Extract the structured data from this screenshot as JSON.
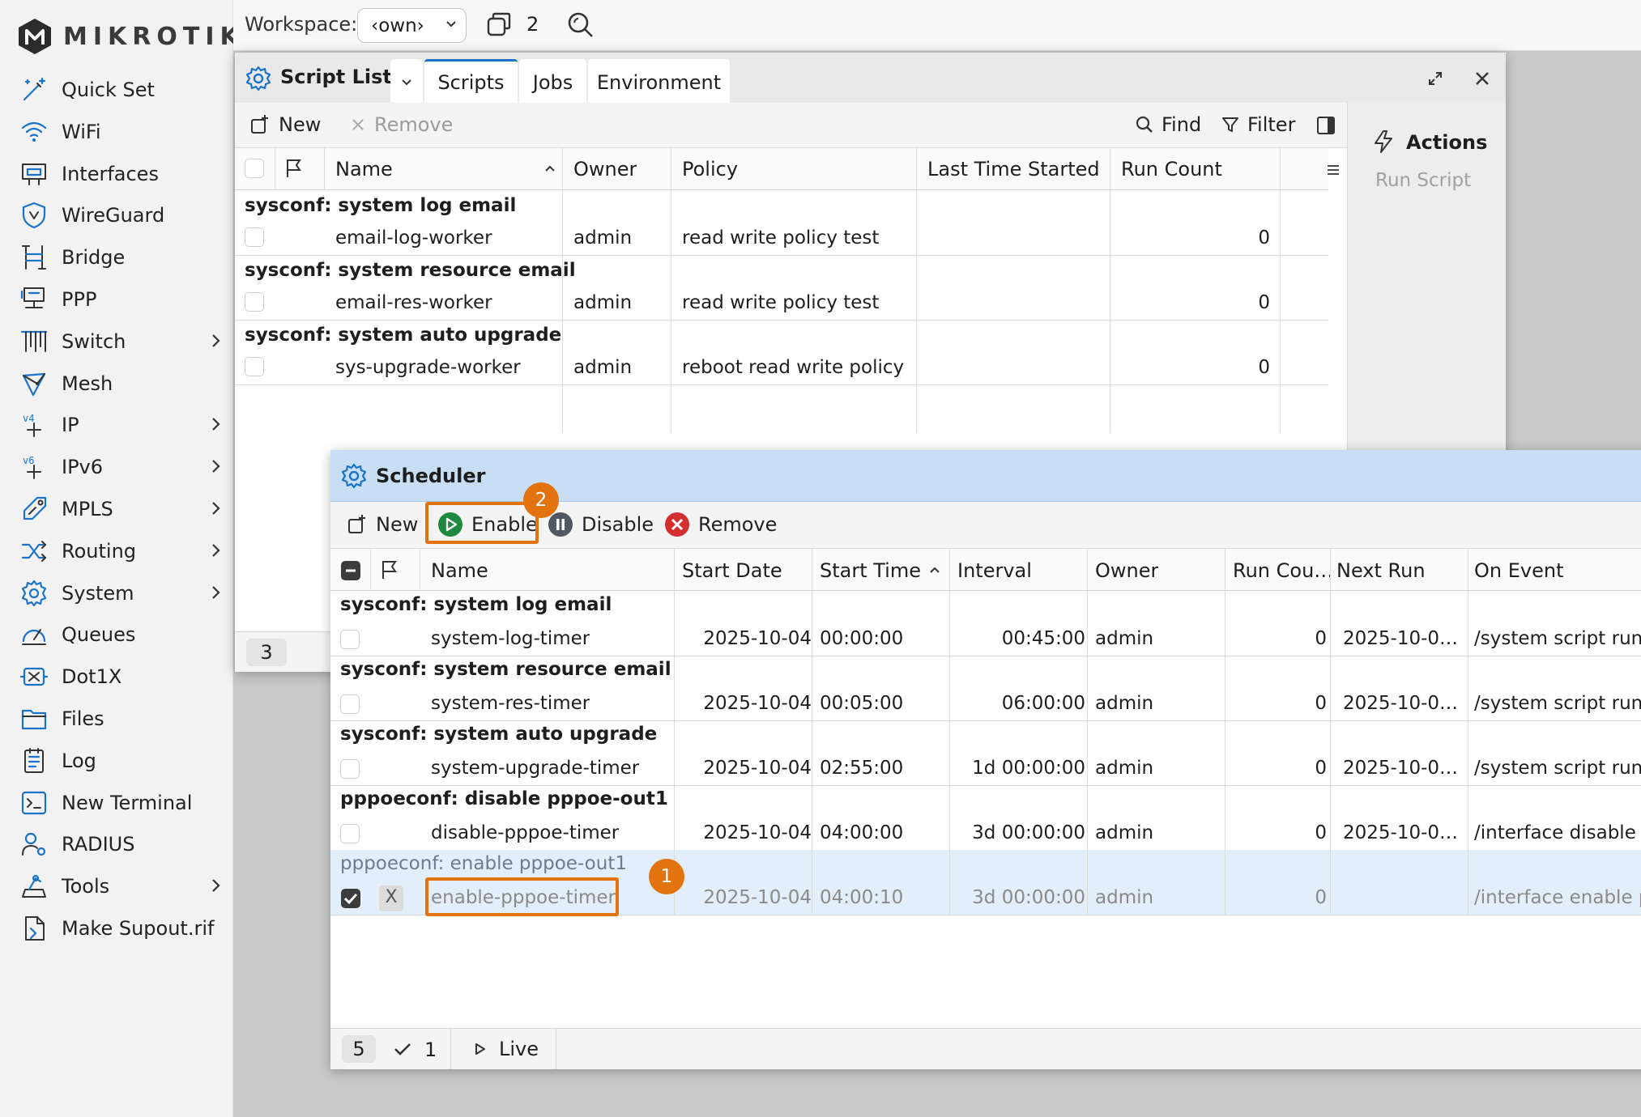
{
  "brand": {
    "logo_text": "MIKROTIK"
  },
  "sidebar": {
    "items": [
      {
        "label": "Quick Set",
        "icon": "wand-icon",
        "submenu": false
      },
      {
        "label": "WiFi",
        "icon": "wifi-icon",
        "submenu": false
      },
      {
        "label": "Interfaces",
        "icon": "interfaces-icon",
        "submenu": false
      },
      {
        "label": "WireGuard",
        "icon": "shield-icon",
        "submenu": false
      },
      {
        "label": "Bridge",
        "icon": "bridge-icon",
        "submenu": false
      },
      {
        "label": "PPP",
        "icon": "ppp-icon",
        "submenu": false
      },
      {
        "label": "Switch",
        "icon": "switch-icon",
        "submenu": true
      },
      {
        "label": "Mesh",
        "icon": "mesh-icon",
        "submenu": false
      },
      {
        "label": "IP",
        "icon": "ip-icon",
        "submenu": true
      },
      {
        "label": "IPv6",
        "icon": "ipv6-icon",
        "submenu": true
      },
      {
        "label": "MPLS",
        "icon": "mpls-icon",
        "submenu": true
      },
      {
        "label": "Routing",
        "icon": "routing-icon",
        "submenu": true
      },
      {
        "label": "System",
        "icon": "gear-icon",
        "submenu": true
      },
      {
        "label": "Queues",
        "icon": "gauge-icon",
        "submenu": false
      },
      {
        "label": "Dot1X",
        "icon": "dot1x-icon",
        "submenu": false
      },
      {
        "label": "Files",
        "icon": "folder-icon",
        "submenu": false
      },
      {
        "label": "Log",
        "icon": "log-icon",
        "submenu": false
      },
      {
        "label": "New Terminal",
        "icon": "terminal-icon",
        "submenu": false
      },
      {
        "label": "RADIUS",
        "icon": "radius-icon",
        "submenu": false
      },
      {
        "label": "Tools",
        "icon": "tools-icon",
        "submenu": true
      },
      {
        "label": "Make Supout.rif",
        "icon": "supout-icon",
        "submenu": false
      }
    ]
  },
  "topbar": {
    "workspace_label": "Workspace:",
    "workspace_value": "‹own›",
    "window_count": "2"
  },
  "script_list": {
    "title": "Script List",
    "tabs": [
      {
        "label": "Scripts",
        "active": true
      },
      {
        "label": "Jobs",
        "active": false
      },
      {
        "label": "Environment",
        "active": false
      }
    ],
    "toolbar": {
      "new": "New",
      "remove": "Remove",
      "find": "Find",
      "filter": "Filter"
    },
    "columns": {
      "name": "Name",
      "owner": "Owner",
      "policy": "Policy",
      "last_started": "Last Time Started",
      "run_count": "Run Count"
    },
    "groups": [
      {
        "title": "sysconf: system log email",
        "name": "email-log-worker",
        "owner": "admin",
        "policy": "read write policy test",
        "last_started": "",
        "run_count": "0"
      },
      {
        "title": "sysconf: system resource email",
        "name": "email-res-worker",
        "owner": "admin",
        "policy": "read write policy test",
        "last_started": "",
        "run_count": "0"
      },
      {
        "title": "sysconf: system auto upgrade",
        "name": "sys-upgrade-worker",
        "owner": "admin",
        "policy": "reboot read write policy",
        "last_started": "",
        "run_count": "0"
      }
    ],
    "status_count": "3",
    "actions": {
      "title": "Actions",
      "run_script": "Run Script"
    }
  },
  "scheduler": {
    "title": "Scheduler",
    "toolbar": {
      "new": "New",
      "enable": "Enable",
      "disable": "Disable",
      "remove": "Remove"
    },
    "columns": {
      "name": "Name",
      "start_date": "Start Date",
      "start_time": "Start Time",
      "interval": "Interval",
      "owner": "Owner",
      "run_count": "Run Cou…",
      "next_run": "Next Run",
      "on_event": "On Event"
    },
    "groups": [
      {
        "title": "sysconf: system log email",
        "name": "system-log-timer",
        "start_date": "2025-10-04",
        "start_time": "00:00:00",
        "interval": "00:45:00",
        "owner": "admin",
        "run_count": "0",
        "next_run": "2025-10-0…",
        "on_event": "/system script run e",
        "selected": false,
        "disabled": false
      },
      {
        "title": "sysconf: system resource email",
        "name": "system-res-timer",
        "start_date": "2025-10-04",
        "start_time": "00:05:00",
        "interval": "06:00:00",
        "owner": "admin",
        "run_count": "0",
        "next_run": "2025-10-0…",
        "on_event": "/system script run e",
        "selected": false,
        "disabled": false
      },
      {
        "title": "sysconf: system auto upgrade",
        "name": "system-upgrade-timer",
        "start_date": "2025-10-04",
        "start_time": "02:55:00",
        "interval": "1d 00:00:00",
        "owner": "admin",
        "run_count": "0",
        "next_run": "2025-10-0…",
        "on_event": "/system script run s",
        "selected": false,
        "disabled": false
      },
      {
        "title": "pppoeconf: disable pppoe-out1",
        "name": "disable-pppoe-timer",
        "start_date": "2025-10-04",
        "start_time": "04:00:00",
        "interval": "3d 00:00:00",
        "owner": "admin",
        "run_count": "0",
        "next_run": "2025-10-0…",
        "on_event": "/interface disable p",
        "selected": false,
        "disabled": false
      },
      {
        "title": "pppoeconf: enable pppoe-out1",
        "name": "enable-pppoe-timer",
        "start_date": "2025-10-04",
        "start_time": "04:00:10",
        "interval": "3d 00:00:00",
        "owner": "admin",
        "run_count": "0",
        "next_run": "",
        "on_event": "/interface enable p",
        "selected": true,
        "disabled": true,
        "flag": "X"
      }
    ],
    "status": {
      "total": "5",
      "selected": "1",
      "live": "Live"
    },
    "annotations": {
      "step1": "1",
      "step2": "2"
    }
  },
  "colors": {
    "accent": "#1a73c8",
    "highlight": "#e3730e",
    "enable_green": "#1f8a3d",
    "remove_red": "#d32f2f",
    "selected_row": "#e2eef9"
  }
}
